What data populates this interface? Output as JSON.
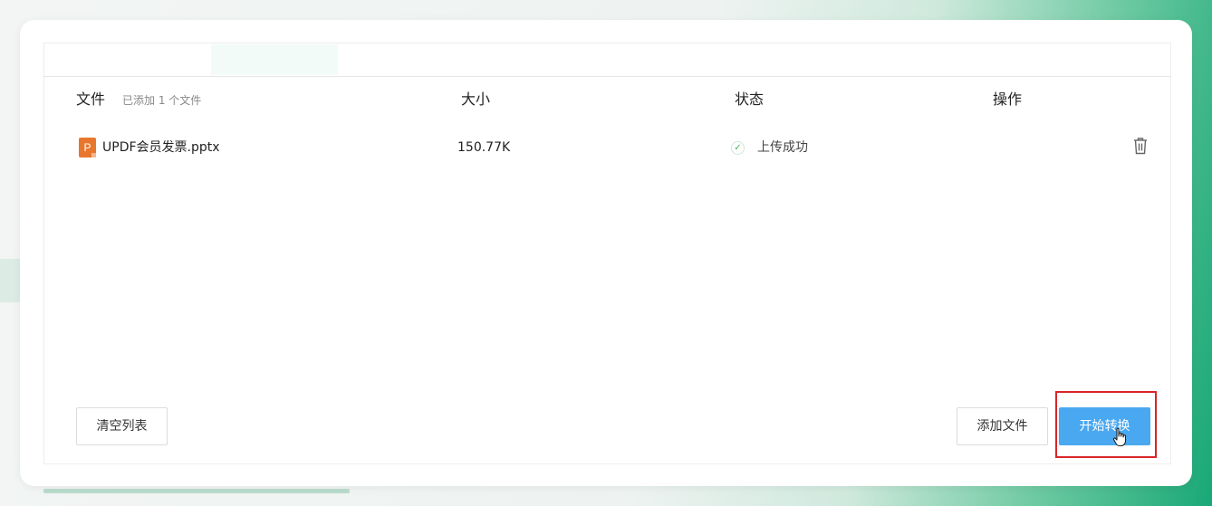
{
  "table": {
    "headers": {
      "file": "文件",
      "file_count": "已添加 1 个文件",
      "size": "大小",
      "status": "状态",
      "actions": "操作"
    },
    "rows": [
      {
        "icon": "pptx-file-icon",
        "icon_letter": "P",
        "name": "UPDF会员发票.pptx",
        "size": "150.77K",
        "status": "上传成功",
        "status_icon": "check-circle-icon",
        "action_icon": "trash-icon"
      }
    ]
  },
  "buttons": {
    "clear": "清空列表",
    "add": "添加文件",
    "start": "开始转换"
  },
  "colors": {
    "primary": "#4aa8f0",
    "success": "#41b05b",
    "file_icon": "#e8772e",
    "highlight": "#d9252a"
  }
}
